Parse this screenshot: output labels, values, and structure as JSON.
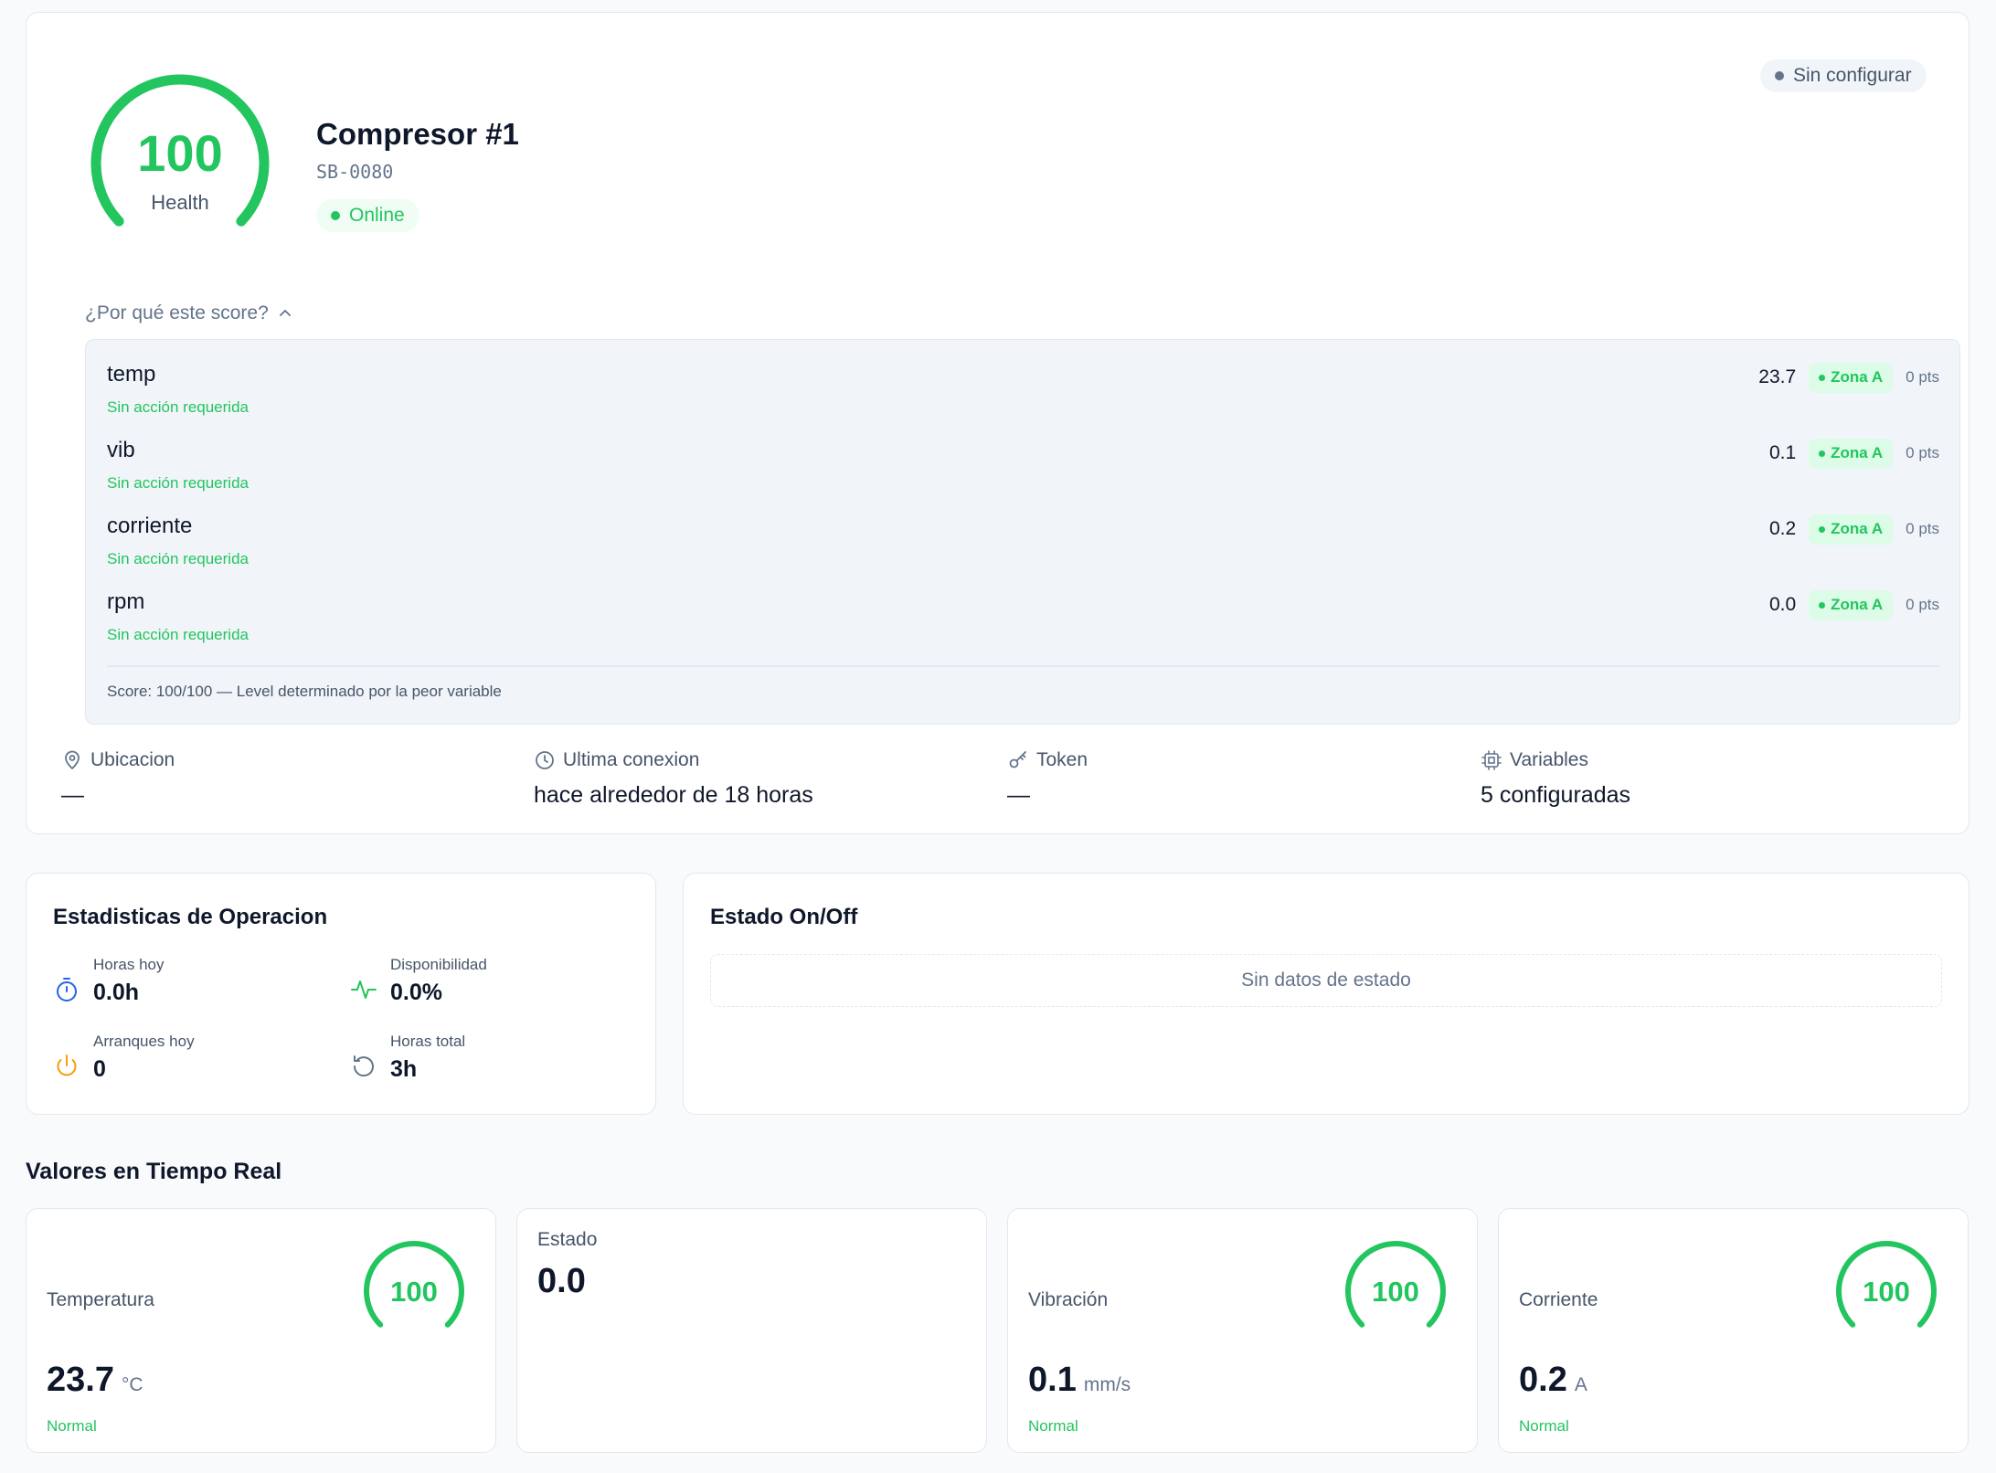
{
  "device": {
    "name": "Compresor #1",
    "id": "SB-0080",
    "status": "Online",
    "config_status": "Sin configurar",
    "health_score": "100",
    "health_label": "Health",
    "health_fraction": 1.0
  },
  "score_breakdown": {
    "toggle_label": "¿Por qué este score?",
    "variables": [
      {
        "name": "temp",
        "action": "Sin acción requerida",
        "value": "23.7",
        "zone": "Zona A",
        "points": "0 pts"
      },
      {
        "name": "vib",
        "action": "Sin acción requerida",
        "value": "0.1",
        "zone": "Zona A",
        "points": "0 pts"
      },
      {
        "name": "corriente",
        "action": "Sin acción requerida",
        "value": "0.2",
        "zone": "Zona A",
        "points": "0 pts"
      },
      {
        "name": "rpm",
        "action": "Sin acción requerida",
        "value": "0.0",
        "zone": "Zona A",
        "points": "0 pts"
      }
    ],
    "footer": "Score: 100/100 — Level determinado por la peor variable"
  },
  "info": {
    "location": {
      "label": "Ubicacion",
      "value": "—"
    },
    "last_connection": {
      "label": "Ultima conexion",
      "value": "hace alrededor de 18 horas"
    },
    "token": {
      "label": "Token",
      "value": "—"
    },
    "variables": {
      "label": "Variables",
      "value": "5 configuradas"
    }
  },
  "operation_stats": {
    "title": "Estadisticas de Operacion",
    "hours_today": {
      "label": "Horas hoy",
      "value": "0.0h"
    },
    "availability": {
      "label": "Disponibilidad",
      "value": "0.0%"
    },
    "starts_today": {
      "label": "Arranques hoy",
      "value": "0"
    },
    "total_hours": {
      "label": "Horas total",
      "value": "3h"
    }
  },
  "on_off": {
    "title": "Estado On/Off",
    "empty_text": "Sin datos de estado"
  },
  "realtime": {
    "title": "Valores en Tiempo Real",
    "cards": [
      {
        "label": "Temperatura",
        "score": "100",
        "value": "23.7",
        "unit": "°C",
        "status": "Normal"
      },
      {
        "label": "Estado",
        "value": "0.0"
      },
      {
        "label": "Vibración",
        "score": "100",
        "value": "0.1",
        "unit": "mm/s",
        "status": "Normal"
      },
      {
        "label": "Corriente",
        "score": "100",
        "value": "0.2",
        "unit": "A",
        "status": "Normal"
      }
    ]
  },
  "colors": {
    "accent_green": "#22c55e",
    "track_gray": "#e2e8f0",
    "text_dark": "#0f172a",
    "text_muted": "#475569"
  }
}
